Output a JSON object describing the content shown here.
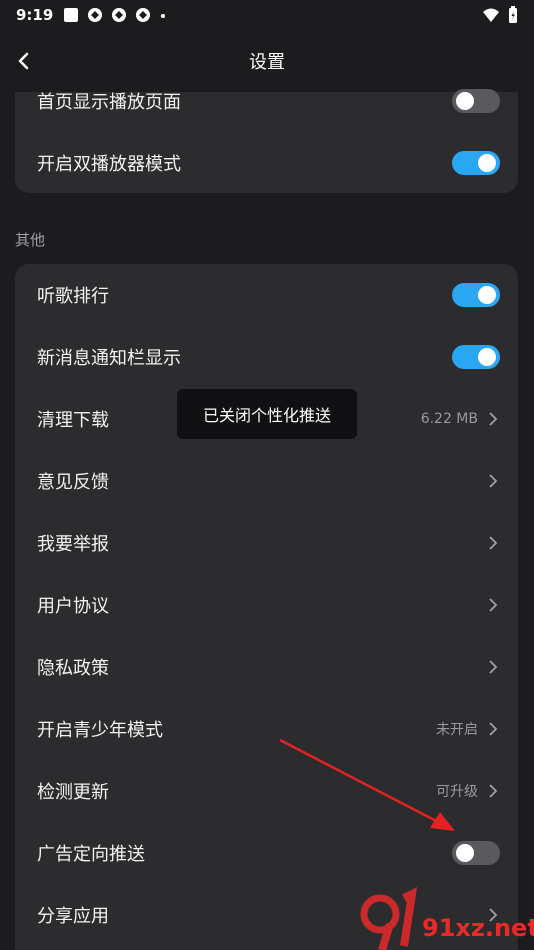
{
  "status_bar": {
    "time": "9:19"
  },
  "header": {
    "title": "设置"
  },
  "top_card": {
    "rows": [
      {
        "label": "首页显示播放页面",
        "toggle": "off"
      },
      {
        "label": "开启双播放器模式",
        "toggle": "on"
      }
    ]
  },
  "other_section": {
    "title": "其他",
    "rows": [
      {
        "label": "听歌排行",
        "toggle": "on"
      },
      {
        "label": "新消息通知栏显示",
        "toggle": "on"
      },
      {
        "label": "清理下载",
        "value": "6.22 MB"
      },
      {
        "label": "意见反馈"
      },
      {
        "label": "我要举报"
      },
      {
        "label": "用户协议"
      },
      {
        "label": "隐私政策"
      },
      {
        "label": "开启青少年模式",
        "value": "未开启"
      },
      {
        "label": "检测更新",
        "value": "可升级"
      },
      {
        "label": "广告定向推送",
        "toggle": "off"
      },
      {
        "label": "分享应用"
      }
    ]
  },
  "toast": {
    "text": "已关闭个性化推送"
  },
  "watermark": {
    "text": "91xz.net"
  },
  "colors": {
    "accent": "#2aa7f2",
    "background": "#1c1c1e",
    "card": "#2c2c2e",
    "annotation_arrow": "#e32323"
  }
}
